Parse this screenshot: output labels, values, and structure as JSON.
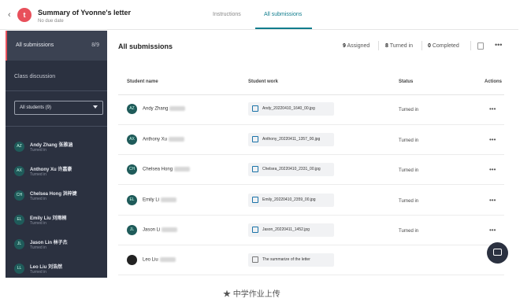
{
  "header": {
    "logo_letter": "t",
    "title": "Summary of Yvonne's letter",
    "subtitle": "No due date",
    "tabs": [
      {
        "label": "Instructions",
        "active": false
      },
      {
        "label": "All submissions",
        "active": true
      }
    ]
  },
  "sidebar": {
    "all_submissions": {
      "label": "All submissions",
      "count": "8/9"
    },
    "class_discussion": "Class discussion",
    "filter": {
      "selected": "All students (9)"
    },
    "students": [
      {
        "initials": "AZ",
        "name": "Andy Zhang 张雅涵",
        "status": "Turned in"
      },
      {
        "initials": "AX",
        "name": "Anthony Xu 许嘉豪",
        "status": "Turned in"
      },
      {
        "initials": "CH",
        "name": "Chelsea Hong 洪梓婕",
        "status": "Turned in"
      },
      {
        "initials": "EL",
        "name": "Emily Liu 刘雨桐",
        "status": "Turned in"
      },
      {
        "initials": "JL",
        "name": "Jason Lin 林子杰",
        "status": "Turned in"
      },
      {
        "initials": "LL",
        "name": "Leo Liu 刘浩然",
        "status": "Turned in"
      }
    ]
  },
  "main": {
    "title": "All submissions",
    "counts": {
      "assigned": {
        "value": "9",
        "label": "Assigned"
      },
      "turned_in": {
        "value": "8",
        "label": "Turned in"
      },
      "completed": {
        "value": "0",
        "label": "Completed"
      }
    },
    "columns": {
      "student": "Student name",
      "work": "Student work",
      "status": "Status",
      "actions": "Actions"
    },
    "rows": [
      {
        "initials": "AZ",
        "name": "Andy Zhang",
        "file": "Andy_20220410_1640_00.jpg",
        "status": "Turned in"
      },
      {
        "initials": "AX",
        "name": "Anthony Xu",
        "file": "Anthony_20220411_1357_00.jpg",
        "status": "Turned in"
      },
      {
        "initials": "CH",
        "name": "Chelsea Hong",
        "file": "Chelsea_20220410_2331_00.jpg",
        "status": "Turned in"
      },
      {
        "initials": "EL",
        "name": "Emily Li",
        "file": "Emily_20220410_2359_00.jpg",
        "status": "Turned in"
      },
      {
        "initials": "JL",
        "name": "Jason Li",
        "file": "Jason_20220411_1452.jpg",
        "status": "Turned in"
      },
      {
        "initials": "",
        "name": "Leo Liu",
        "file": "The summarize of the letter",
        "status": ""
      }
    ],
    "more_label": "•••"
  },
  "caption": "★ 中学作业上传",
  "colors": {
    "accent": "#0e7c8c",
    "logo": "#e8505b",
    "sidebar": "#2b3140"
  }
}
